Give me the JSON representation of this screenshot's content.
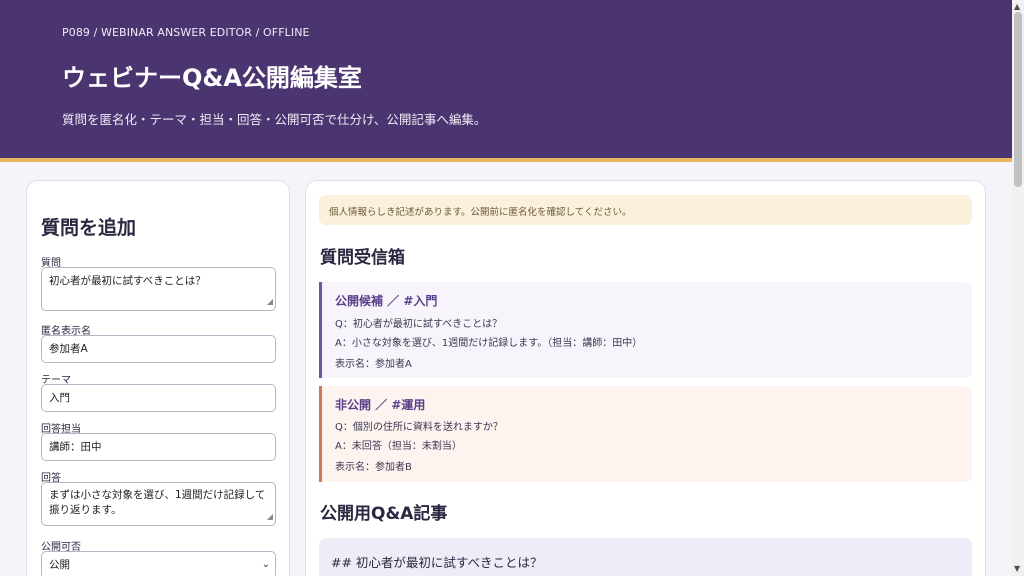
{
  "header": {
    "breadcrumb": "P089 / WEBINAR ANSWER EDITOR / OFFLINE",
    "title": "ウェビナーQ&A公開編集室",
    "subtitle": "質問を匿名化・テーマ・担当・回答・公開可否で仕分け、公開記事へ編集。"
  },
  "form": {
    "title": "質問を追加",
    "question_label": "質問",
    "question_value": "初心者が最初に試すべきことは？",
    "anon_label": "匿名表示名",
    "anon_value": "参加者A",
    "theme_label": "テーマ",
    "theme_value": "入門",
    "assignee_label": "回答担当",
    "assignee_value": "講師：田中",
    "answer_label": "回答",
    "answer_value": "まずは小さな対象を選び、1週間だけ記録して振り返ります。",
    "publish_label": "公開可否",
    "publish_value": "公開"
  },
  "inbox": {
    "warning": "個人情報らしき記述があります。公開前に匿名化を確認してください。",
    "title": "質問受信箱",
    "items": [
      {
        "heading": "公開候補 ／ #入門",
        "question": "Q：初心者が最初に試すべきことは？",
        "answer": "A：小さな対象を選び、1週間だけ記録します。（担当：講師：田中）",
        "display_name": "表示名：参加者A"
      },
      {
        "heading": "非公開 ／ #運用",
        "question": "Q：個別の住所に資料を送れますか？",
        "answer": "A：未回答（担当：未割当）",
        "display_name": "表示名：参加者B"
      }
    ]
  },
  "article": {
    "title": "公開用Q&A記事",
    "first_line": "## 初心者が最初に試すべきことは？"
  },
  "colors": {
    "header_bg": "#4b3570",
    "accent_line": "#e6b75c",
    "public_border": "#7054a0",
    "private_border": "#c97a55"
  }
}
